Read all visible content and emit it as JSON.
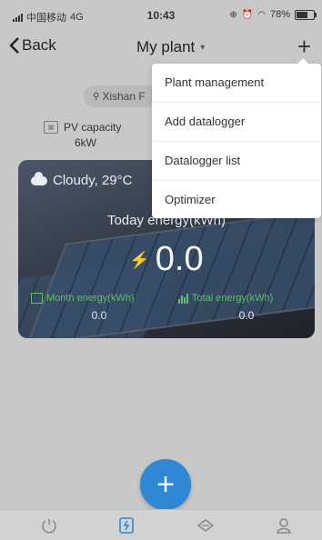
{
  "status_bar": {
    "carrier": "中国移动",
    "network": "4G",
    "time": "10:43",
    "battery": "78%",
    "battery_level": 0.78
  },
  "nav": {
    "back_label": "Back",
    "title": "My plant"
  },
  "plant": {
    "location": "Xishan F",
    "pv_label": "PV capacity",
    "pv_value": "6kW"
  },
  "energy": {
    "weather": "Cloudy,  29°C",
    "today_label": "Today energy(kWh)",
    "today_value": "0.0",
    "month_label": "Month energy(kWh)",
    "month_value": "0.0",
    "total_label": "Total energy(kWh)",
    "total_value": "0.0"
  },
  "menu": {
    "items": [
      "Plant management",
      "Add datalogger",
      "Datalogger list",
      "Optimizer"
    ]
  },
  "tabs": [
    {
      "icon": "power-icon"
    },
    {
      "icon": "plant-icon",
      "active": true
    },
    {
      "icon": "service-icon"
    },
    {
      "icon": "user-icon"
    }
  ],
  "colors": {
    "accent": "#2e88d6",
    "energy_green": "#5fbf6a"
  }
}
